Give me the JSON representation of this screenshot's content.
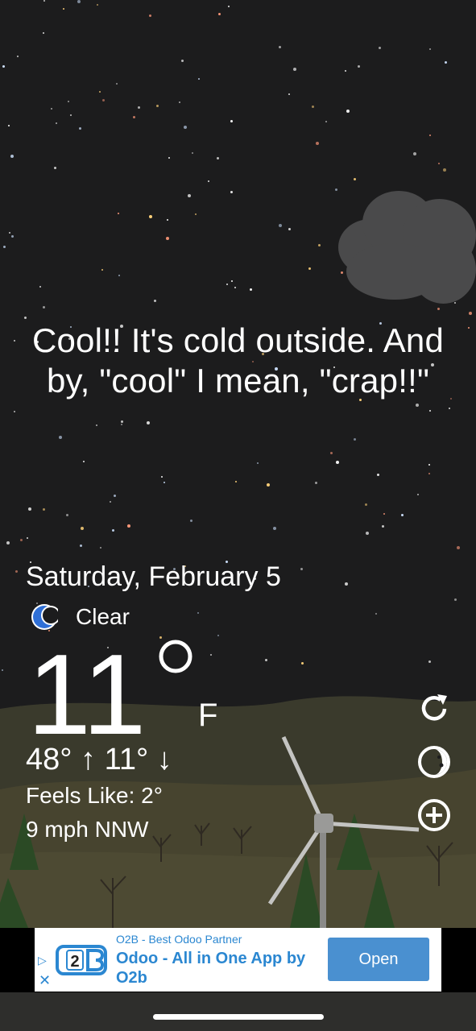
{
  "quote": "Cool!! It's cold outside. And by, \"cool\" I mean, \"crap!!\"",
  "date": "Saturday, February 5",
  "condition": {
    "icon": "moon-crescent-icon",
    "label": "Clear"
  },
  "temperature": {
    "value": "11",
    "unit": "F"
  },
  "high_low": "48° ↑  11° ↓",
  "feels_like": "Feels Like: 2°",
  "wind": "9 mph NNW",
  "side_buttons": [
    "refresh-icon",
    "moon-phase-icon",
    "add-icon"
  ],
  "ad": {
    "subtitle": "O2B - Best Odoo Partner",
    "title": "Odoo - All in One App by O2b",
    "open_label": "Open",
    "logo_text": "2"
  },
  "colors": {
    "sky": "#1c1c1d",
    "ad_accent": "#2b87d1",
    "moon": "#2f6fd6"
  }
}
